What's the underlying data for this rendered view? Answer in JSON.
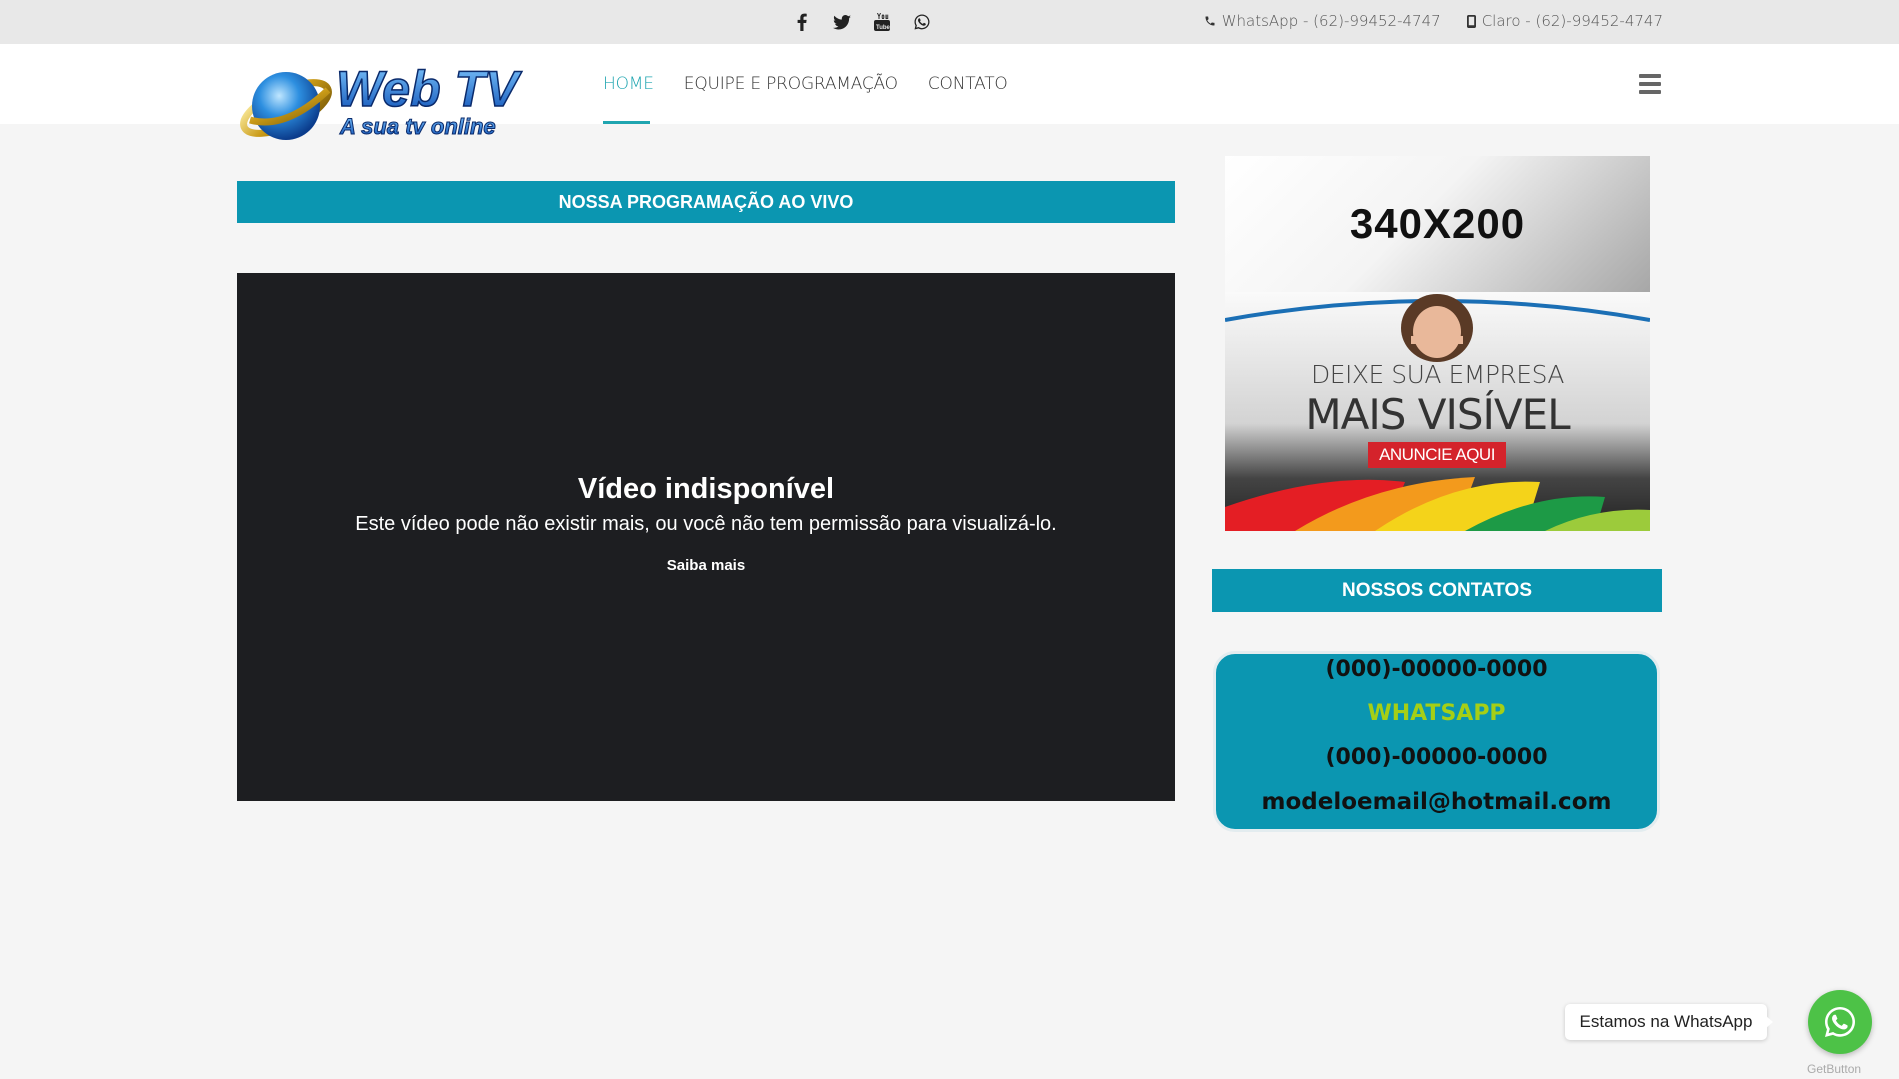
{
  "topbar": {
    "social_icons": [
      "facebook-icon",
      "twitter-icon",
      "youtube-icon",
      "whatsapp-icon"
    ],
    "whatsapp_contact": "WhatsApp - (62)-99452-4747",
    "claro_contact": "Claro - (62)-99452-4747"
  },
  "header": {
    "logo_title": "Web TV",
    "logo_subtitle": "A sua tv online",
    "nav": [
      {
        "label": "HOME",
        "active": true
      },
      {
        "label": "EQUIPE E PROGRAMAÇÃO",
        "active": false
      },
      {
        "label": "CONTATO",
        "active": false
      }
    ],
    "menu_icon": "hamburger-icon"
  },
  "main": {
    "live_title": "NOSSA PROGRAMAÇÃO AO VIVO",
    "video": {
      "title": "Vídeo indisponível",
      "message": "Este vídeo pode não existir mais, ou você não tem permissão para visualizá-lo.",
      "link": "Saiba mais"
    }
  },
  "sidebar": {
    "ad": {
      "size_label": "340X200",
      "line1": "DEIXE SUA EMPRESA",
      "line2": "MAIS VISÍVEL",
      "cta": "ANUNCIE AQUI"
    },
    "contacts_title": "NOSSOS CONTATOS",
    "contacts": {
      "phone1": "(000)-00000-0000",
      "whatsapp_label": "WHATSAPP",
      "phone2": "(000)-00000-0000",
      "email": "modeloemail@hotmail.com"
    }
  },
  "whatsapp_widget": {
    "bubble_text": "Estamos na WhatsApp",
    "credit": "GetButton"
  },
  "colors": {
    "accent": "#0b96b1",
    "nav_active": "#1fa5b0",
    "whatsapp_label": "#a5cf16",
    "whatsapp_button": "#4dc247"
  }
}
